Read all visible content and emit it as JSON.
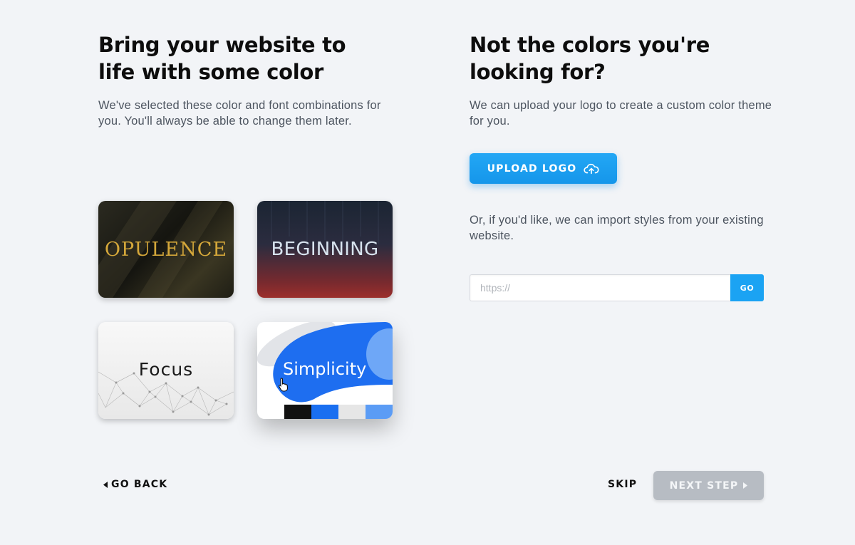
{
  "left": {
    "title_line1": "Bring your website to",
    "title_line2": "life with some color",
    "description": "We've selected these color and font combinations for you. You'll always be able to change them later."
  },
  "right": {
    "title_line1": "Not the colors you're",
    "title_line2": "looking for?",
    "description": "We can upload your logo to create a custom color theme for you.",
    "upload_label": "UPLOAD LOGO",
    "upload_icon": "cloud-upload-icon",
    "import_text": "Or, if you'd like, we can import styles from your existing website.",
    "url_placeholder": "https://",
    "go_label": "GO"
  },
  "themes": [
    {
      "name": "OPULENCE"
    },
    {
      "name": "BEGINNING"
    },
    {
      "name": "Focus"
    },
    {
      "name": "Simplicity",
      "swatches": [
        "#111111",
        "#1a6ff0",
        "#e6e6e6",
        "#5b9cf5"
      ]
    }
  ],
  "footer": {
    "back_label": "GO BACK",
    "skip_label": "SKIP",
    "next_label": "NEXT STEP"
  },
  "colors": {
    "accent": "#1ba3f3",
    "disabled": "#b7bcc3"
  }
}
